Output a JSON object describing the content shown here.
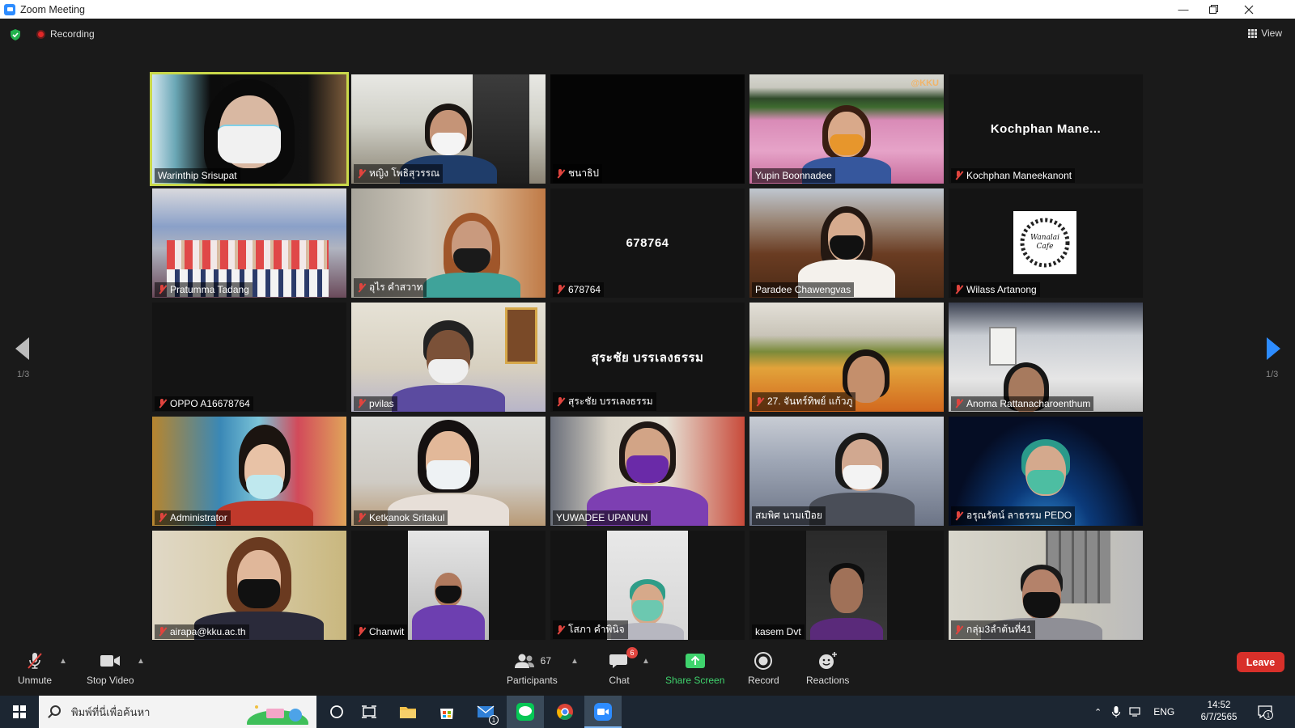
{
  "window": {
    "title": "Zoom Meeting"
  },
  "topbar": {
    "recording_label": "Recording",
    "view_label": "View"
  },
  "pager": {
    "left_page": "1/3",
    "right_page": "1/3"
  },
  "tiles": [
    {
      "name": "Warinthip Srisupat",
      "muted": false,
      "active": true
    },
    {
      "name": "หญิง โพธิสุวรรณ",
      "muted": true
    },
    {
      "name": "ชนาธิป",
      "muted": true
    },
    {
      "name": "Yupin Boonnadee",
      "muted": false,
      "watermark": "@KKU"
    },
    {
      "name": "Kochphan Maneekanont",
      "muted": true,
      "center_text": "Kochphan  Mane..."
    },
    {
      "name": "Pratumma Tadang",
      "muted": true
    },
    {
      "name": "อุไร คำสวาท",
      "muted": true
    },
    {
      "name": "678764",
      "muted": true,
      "center_text": "678764"
    },
    {
      "name": "Paradee Chawengvas",
      "muted": false
    },
    {
      "name": "Wilass Artanong",
      "muted": true,
      "logo_text": "Wanalai Cafe"
    },
    {
      "name": "OPPO A16678764",
      "muted": true
    },
    {
      "name": "pvilas",
      "muted": true
    },
    {
      "name": "สุระชัย บรรเลงธรรม",
      "muted": true,
      "center_text": "สุระชัย บรรเลงธรรม"
    },
    {
      "name": "27. จันทร์ทิพย์ แก้วภู",
      "muted": true
    },
    {
      "name": "Anoma Rattanacharoenthum",
      "muted": true
    },
    {
      "name": "Administrator",
      "muted": true
    },
    {
      "name": "Ketkanok Sritakul",
      "muted": true
    },
    {
      "name": "YUWADEE UPANUN",
      "muted": false
    },
    {
      "name": "สมพิศ นามเปือย",
      "muted": false
    },
    {
      "name": "อรุณรัตน์ ลาธรรม PEDO",
      "muted": true
    },
    {
      "name": "airapa@kku.ac.th",
      "muted": true
    },
    {
      "name": "Chanwit",
      "muted": true
    },
    {
      "name": "โสภา คำพินิจ",
      "muted": true
    },
    {
      "name": "kasem Dvt",
      "muted": false
    },
    {
      "name": "กลุ่ม3ลำต้นที่41",
      "muted": true
    }
  ],
  "toolbar": {
    "unmute": "Unmute",
    "stop_video": "Stop Video",
    "participants": "Participants",
    "participants_count": "67",
    "chat": "Chat",
    "chat_badge": "6",
    "share_screen": "Share Screen",
    "record": "Record",
    "reactions": "Reactions",
    "leave": "Leave"
  },
  "taskbar": {
    "search_placeholder": "พิมพ์ที่นี่เพื่อค้นหา",
    "mail_badge": "1",
    "language": "ENG",
    "time": "14:52",
    "date": "6/7/2565",
    "notification_count": "1"
  },
  "colors": {
    "accent": "#2d8cff",
    "leave": "#d8302a",
    "share": "#3fd36d",
    "active_border": "#c9d84a"
  }
}
